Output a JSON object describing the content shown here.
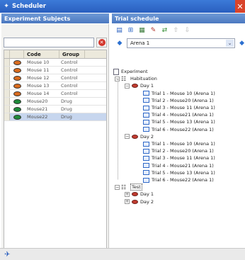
{
  "window": {
    "title": "Scheduler",
    "close_glyph": "✕"
  },
  "left_panel": {
    "header": "Experiment Subjects",
    "search": {
      "value": "",
      "placeholder": ""
    },
    "columns": [
      "",
      "Code",
      "Group"
    ],
    "rows": [
      {
        "code": "Mouse 10",
        "group": "Control",
        "color": "#d96b1e"
      },
      {
        "code": "Mouse 11",
        "group": "Control",
        "color": "#d96b1e"
      },
      {
        "code": "Mouse 12",
        "group": "Control",
        "color": "#d96b1e"
      },
      {
        "code": "Mouse 13",
        "group": "Control",
        "color": "#d96b1e"
      },
      {
        "code": "Mouse 14",
        "group": "Control",
        "color": "#d96b1e"
      },
      {
        "code": "Mouse20",
        "group": "Drug",
        "color": "#1e8a3a"
      },
      {
        "code": "Mouse21",
        "group": "Drug",
        "color": "#1e8a3a"
      },
      {
        "code": "Mouse22",
        "group": "Drug",
        "color": "#1e8a3a"
      }
    ],
    "selected_row_index": 7
  },
  "right_panel": {
    "header": "Trial schedule",
    "toolbar_icons": [
      "save-icon",
      "add-trial-icon",
      "add-block-icon",
      "edit-icon",
      "randomize-icon",
      "move-up-icon",
      "move-down-icon"
    ],
    "arena": {
      "selected": "Arena 1"
    },
    "tree": {
      "root": "Experiment",
      "stages": [
        {
          "label": "Habituation",
          "days": [
            {
              "label": "Day 1",
              "trials": [
                "Trial 1 - Mouse 10 (Arena 1)",
                "Trial 2 - Mouse20 (Arena 1)",
                "Trial 3 - Mouse 11 (Arena 1)",
                "Trial 4 - Mouse21 (Arena 1)",
                "Trial 5 - Mouse 13 (Arena 1)",
                "Trial 6 - Mouse22 (Arena 1)"
              ]
            },
            {
              "label": "Day 2",
              "trials": [
                "Trial 1 - Mouse 10 (Arena 1)",
                "Trial 2 - Mouse20 (Arena 1)",
                "Trial 3 - Mouse 11 (Arena 1)",
                "Trial 4 - Mouse21 (Arena 1)",
                "Trial 5 - Mouse 13 (Arena 1)",
                "Trial 6 - Mouse22 (Arena 1)"
              ]
            }
          ]
        },
        {
          "label": "Test",
          "days": [
            {
              "label": "Day 1",
              "trials": []
            },
            {
              "label": "Day 2",
              "trials": []
            }
          ]
        }
      ]
    }
  }
}
